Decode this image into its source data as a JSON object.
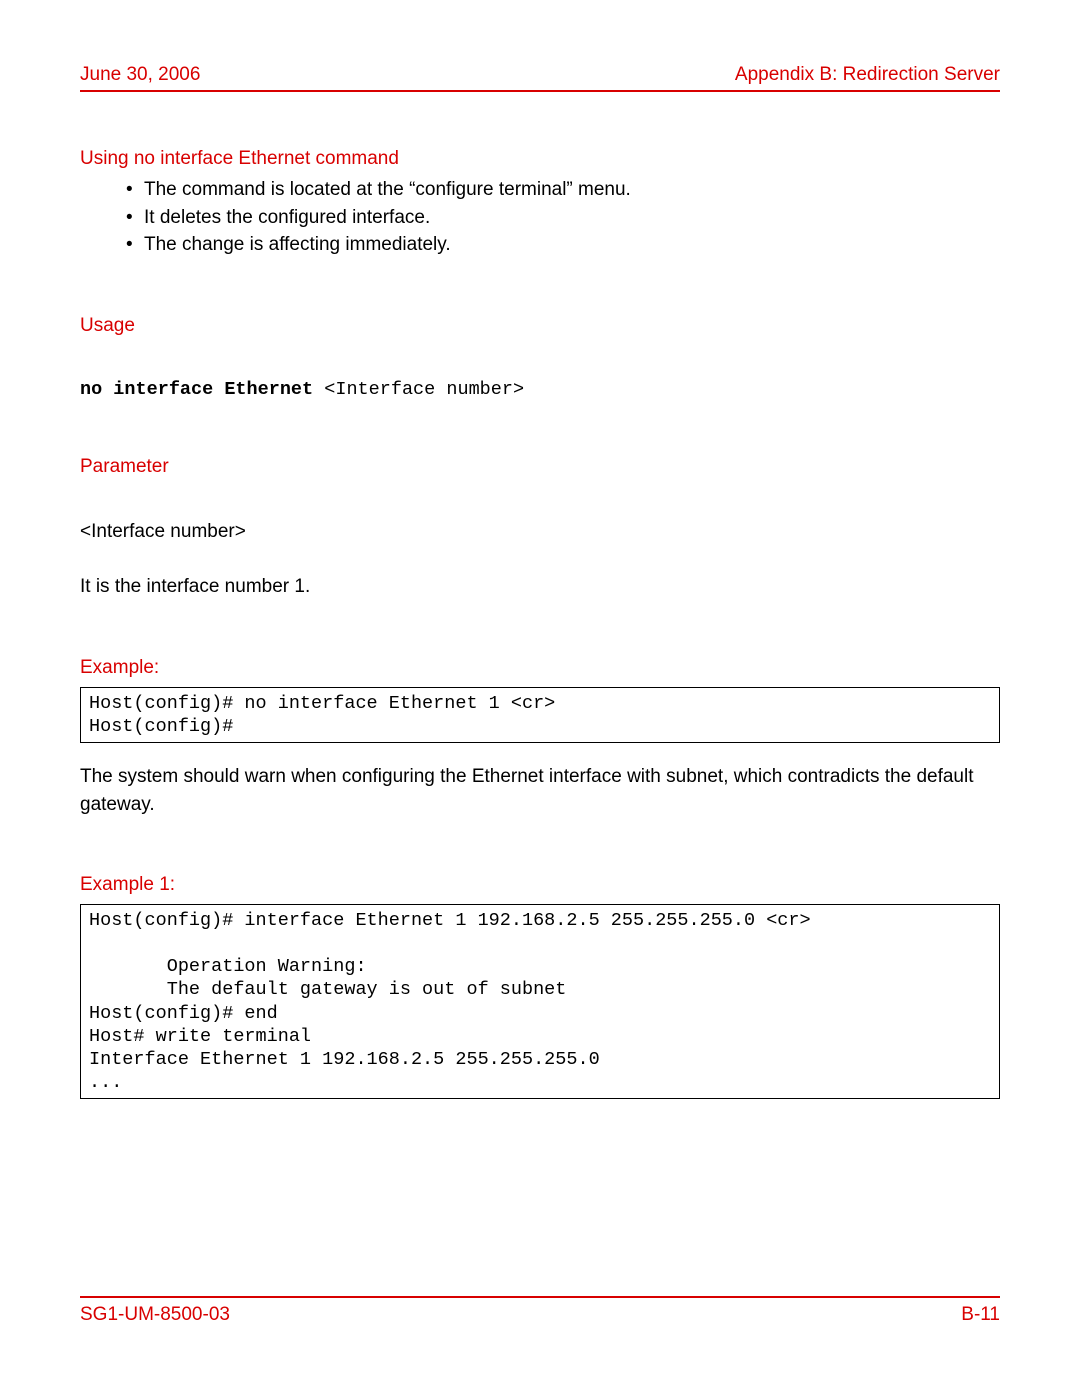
{
  "header": {
    "date": "June 30, 2006",
    "appendix": "Appendix B: Redirection Server"
  },
  "sections": {
    "using_no_if": {
      "title": "Using no interface Ethernet command",
      "bullets": [
        "The command is located at the “configure terminal” menu.",
        "It deletes the configured interface.",
        "The change is affecting immediately."
      ]
    },
    "usage": {
      "title": "Usage",
      "cmd_bold": "no interface Ethernet",
      "cmd_rest": " <Interface number>"
    },
    "parameter": {
      "title": "Parameter",
      "line1": "<Interface number>",
      "line2": "It is the interface number 1."
    },
    "example": {
      "title": "Example:",
      "code": "Host(config)# no interface Ethernet 1 <cr>\nHost(config)#",
      "after": "The system should warn when configuring the Ethernet interface with subnet, which contradicts the default gateway."
    },
    "example1": {
      "title": "Example 1:",
      "code": "Host(config)# interface Ethernet 1 192.168.2.5 255.255.255.0 <cr>\n\n       Operation Warning:\n       The default gateway is out of subnet\nHost(config)# end\nHost# write terminal\nInterface Ethernet 1 192.168.2.5 255.255.255.0\n..."
    }
  },
  "footer": {
    "docid": "SG1-UM-8500-03",
    "page": "B-11"
  }
}
